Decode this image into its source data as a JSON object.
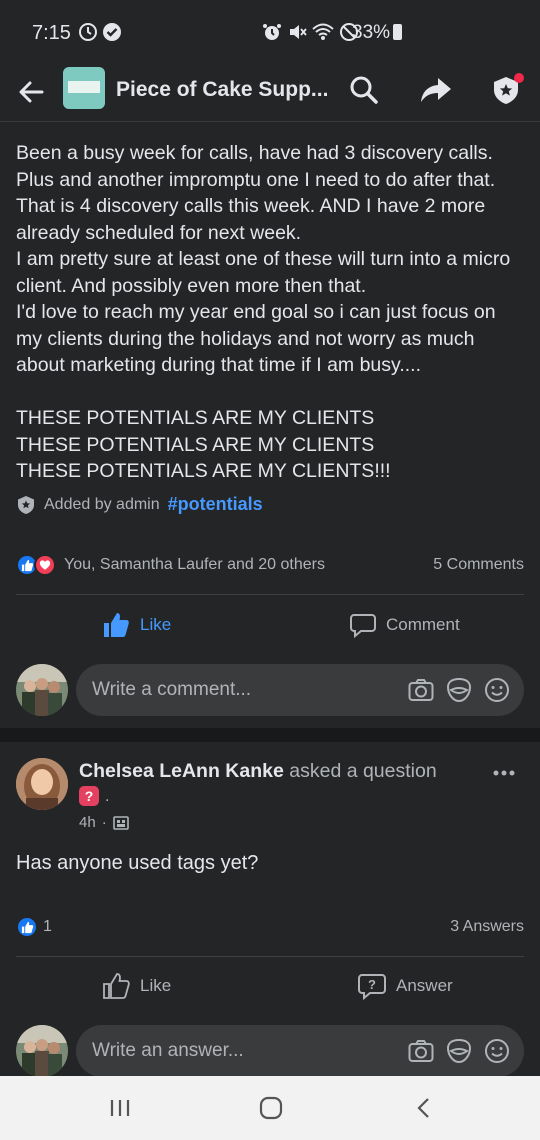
{
  "status_bar": {
    "time": "7:15",
    "battery": "33%"
  },
  "header": {
    "group_title": "Piece of Cake Supp..."
  },
  "post": {
    "text": "Been a busy week for calls, have had 3 discovery calls. Plus and another impromptu one I need to do after that. That is 4 discovery calls this week. AND I have 2 more already scheduled for next week.\nI am pretty sure at least one of these will turn into a micro client. And possibly even more then that.\nI'd love to reach my year end goal so i can just focus on my clients during the holidays and not worry as much about marketing during that time if I am busy....\n\nTHESE POTENTIALS ARE MY CLIENTS\nTHESE POTENTIALS ARE MY CLIENTS\nTHESE POTENTIALS ARE MY CLIENTS!!!",
    "added_by": "Added by admin",
    "hashtag": "#potentials",
    "reactions_text": "You, Samantha Laufer and 20 others",
    "comment_count": "5 Comments",
    "like_label": "Like",
    "comment_label": "Comment",
    "comment_placeholder": "Write a comment..."
  },
  "question_post": {
    "author": "Chelsea LeAnn Kanke",
    "action": "asked a question",
    "question_badge": "?",
    "badge_dot": ".",
    "time": "4h",
    "text": "Has anyone used tags yet?",
    "reaction_count": "1",
    "answer_count": "3 Answers",
    "like_label": "Like",
    "answer_label": "Answer",
    "answer_placeholder": "Write an answer..."
  },
  "colors": {
    "background": "#242526",
    "accent_blue": "#4599ff",
    "love_red": "#f33e58",
    "question_pink": "#e4405f"
  },
  "icons": [
    "back-arrow-icon",
    "search-icon",
    "share-icon",
    "admin-shield-icon",
    "camera-icon",
    "gif-icon",
    "emoji-icon",
    "like-icon",
    "comment-icon",
    "answer-icon",
    "more-icon",
    "privacy-icon"
  ]
}
